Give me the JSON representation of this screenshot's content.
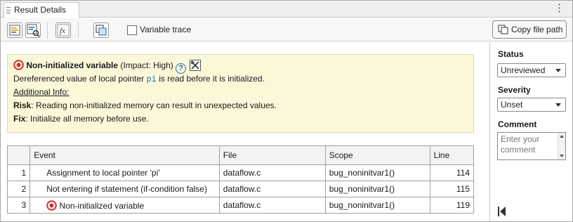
{
  "tab": {
    "title": "Result Details",
    "menu_glyph": "⋮"
  },
  "toolbar": {
    "variable_trace_label": "Variable trace",
    "variable_trace_checked": false,
    "copy_file_path_label": "Copy file path",
    "fx_glyph": "fx"
  },
  "defect": {
    "name": "Non-initialized variable",
    "impact": "(Impact: High)",
    "help_glyph": "?",
    "message_pre": "Dereferenced value of local pointer ",
    "message_code": "pi",
    "message_post": " is read before it is initialized.",
    "additional_info_label": "Additional Info:",
    "risk_label": "Risk",
    "risk_text": ": Reading non-initialized memory can result in unexpected values.",
    "fix_label": "Fix",
    "fix_text": ": Initialize all memory before use."
  },
  "events_table": {
    "headers": {
      "event": "Event",
      "file": "File",
      "scope": "Scope",
      "line": "Line"
    },
    "rows": [
      {
        "index": "1",
        "event": "Assignment to local pointer 'pi'",
        "file": "dataflow.c",
        "scope": "bug_noninitvar1()",
        "line": "114",
        "icon": ""
      },
      {
        "index": "2",
        "event": "Not entering if statement (if-condition false)",
        "file": "dataflow.c",
        "scope": "bug_noninitvar1()",
        "line": "115",
        "icon": ""
      },
      {
        "index": "3",
        "event": "Non-initialized variable",
        "file": "dataflow.c",
        "scope": "bug_noninitvar1()",
        "line": "119",
        "icon": "stop-icon"
      }
    ]
  },
  "side": {
    "status_label": "Status",
    "status_value": "Unreviewed",
    "severity_label": "Severity",
    "severity_value": "Unset",
    "comment_label": "Comment",
    "comment_placeholder": "Enter your comment"
  },
  "colors": {
    "defect_background": "#fbf7d9",
    "stop_icon_red": "#d32f2f",
    "code_blue": "#2a6db5"
  }
}
